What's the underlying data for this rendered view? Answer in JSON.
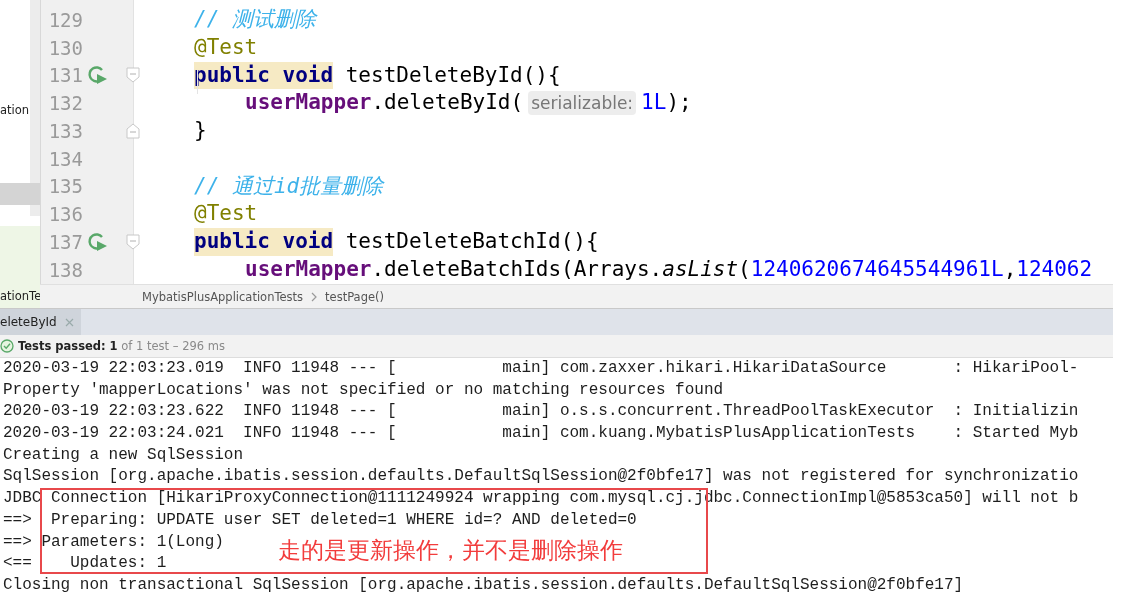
{
  "project_panel": {
    "items": [
      {
        "text": "ation",
        "kind": "plain"
      },
      {
        "text": "ationTe",
        "kind": "test"
      }
    ]
  },
  "editor": {
    "lines": [
      {
        "number": "129",
        "kind": "member",
        "run": false,
        "tokens": [
          {
            "kind": "comment",
            "text": "// 测试删除"
          }
        ]
      },
      {
        "number": "130",
        "kind": "member",
        "run": false,
        "tokens": [
          {
            "kind": "annotation",
            "text": "@Test"
          }
        ]
      },
      {
        "number": "131",
        "kind": "member",
        "run": true,
        "fold_start": true,
        "tokens": [
          {
            "kind": "keyword",
            "text": "public void"
          },
          {
            "kind": "plain",
            "text": " testDeleteById(){"
          }
        ]
      },
      {
        "number": "132",
        "kind": "statement",
        "run": false,
        "tokens": [
          {
            "kind": "field",
            "text": "userMapper"
          },
          {
            "kind": "plain",
            "text": ".deleteById("
          },
          {
            "kind": "hint",
            "text": "serializable:"
          },
          {
            "kind": "number",
            "text": "1L"
          },
          {
            "kind": "plain",
            "text": ");"
          }
        ]
      },
      {
        "number": "133",
        "kind": "member",
        "run": false,
        "fold_end": true,
        "tokens": [
          {
            "kind": "plain",
            "text": "}"
          }
        ]
      },
      {
        "number": "134",
        "kind": "blank",
        "run": false
      },
      {
        "number": "135",
        "kind": "member",
        "run": false,
        "tokens": [
          {
            "kind": "comment",
            "text": "// 通过id批量删除"
          }
        ]
      },
      {
        "number": "136",
        "kind": "member",
        "run": false,
        "tokens": [
          {
            "kind": "annotation",
            "text": "@Test"
          }
        ]
      },
      {
        "number": "137",
        "kind": "member",
        "run": true,
        "fold_start": true,
        "tokens": [
          {
            "kind": "keyword",
            "text": "public void"
          },
          {
            "kind": "plain",
            "text": " testDeleteBatchId(){"
          }
        ]
      },
      {
        "number": "138",
        "kind": "statement",
        "run": false,
        "tokens": [
          {
            "kind": "field",
            "text": "userMapper"
          },
          {
            "kind": "plain",
            "text": ".deleteBatchIds(Arrays."
          },
          {
            "kind": "static",
            "text": "asList"
          },
          {
            "kind": "plain",
            "text": "("
          },
          {
            "kind": "number",
            "text": "1240620674645544961L"
          },
          {
            "kind": "plain",
            "text": ","
          },
          {
            "kind": "number",
            "text": "124062"
          }
        ]
      }
    ],
    "breadcrumb": [
      "MybatisPlusApplicationTests",
      "testPage()"
    ]
  },
  "run_panel": {
    "tab": {
      "label": "eleteById",
      "selected": true
    },
    "status": "**Tests passed: 1** of 1 test – 296 ms",
    "console": [
      "2020-03-19 22:03:23.019  INFO 11948 --- [           main] com.zaxxer.hikari.HikariDataSource       : HikariPool-",
      "Property 'mapperLocations' was not specified or no matching resources found",
      "2020-03-19 22:03:23.622  INFO 11948 --- [           main] o.s.s.concurrent.ThreadPoolTaskExecutor  : Initializin",
      "2020-03-19 22:03:24.021  INFO 11948 --- [           main] com.kuang.MybatisPlusApplicationTests    : Started Myb",
      "Creating a new SqlSession",
      "SqlSession [org.apache.ibatis.session.defaults.DefaultSqlSession@2f0bfe17] was not registered for synchronizatio",
      "JDBC Connection [HikariProxyConnection@1111249924 wrapping com.mysql.cj.jdbc.ConnectionImpl@5853ca50] will not b",
      "==>  Preparing: UPDATE user SET deleted=1 WHERE id=? AND deleted=0",
      "==> Parameters: 1(Long)",
      "<==    Updates: 1",
      "Closing non transactional SqlSession [org.apache.ibatis.session.defaults.DefaultSqlSession@2f0bfe17]"
    ],
    "annotation": "走的是更新操作，并不是删除操作"
  }
}
